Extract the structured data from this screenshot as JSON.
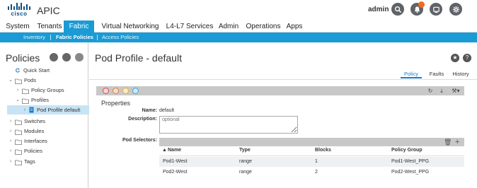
{
  "header": {
    "logo_text": "cisco",
    "app_title": "APIC",
    "user": "admin",
    "icons": [
      "search-icon",
      "alert-icon",
      "tools-icon",
      "settings-icon"
    ],
    "colors": {
      "accent": "#1a9bd6",
      "alert": "#f26b1d",
      "logo": "#0a4f83"
    }
  },
  "nav": {
    "tabs": [
      "System",
      "Tenants",
      "Fabric",
      "Virtual Networking",
      "L4-L7 Services",
      "Admin",
      "Operations",
      "Apps"
    ],
    "active": "Fabric",
    "subtabs": [
      "Inventory",
      "Fabric Policies",
      "Access Policies"
    ],
    "active_sub": "Fabric Policies"
  },
  "sidebar": {
    "title": "Policies",
    "items": [
      {
        "label": "Quick Start"
      },
      {
        "label": "Pods"
      },
      {
        "label": "Policy Groups"
      },
      {
        "label": "Profiles"
      },
      {
        "label": "Pod Profile default"
      },
      {
        "label": "Switches"
      },
      {
        "label": "Modules"
      },
      {
        "label": "Interfaces"
      },
      {
        "label": "Policies"
      },
      {
        "label": "Tags"
      }
    ]
  },
  "main": {
    "title": "Pod Profile - default",
    "tabs": [
      "Policy",
      "Faults",
      "History"
    ],
    "active_tab": "Policy",
    "properties_title": "Properties",
    "name_label": "Name:",
    "name_value": "default",
    "description_label": "Description:",
    "description_placeholder": "optional",
    "pod_selectors_label": "Pod Selectors:",
    "table": {
      "columns": [
        "Name",
        "Type",
        "Blocks",
        "Policy Group"
      ],
      "rows": [
        [
          "Pod1-West",
          "range",
          "1",
          "Pod1-West_PPG"
        ],
        [
          "Pod2-West",
          "range",
          "2",
          "Pod2-West_PPG"
        ]
      ]
    }
  }
}
